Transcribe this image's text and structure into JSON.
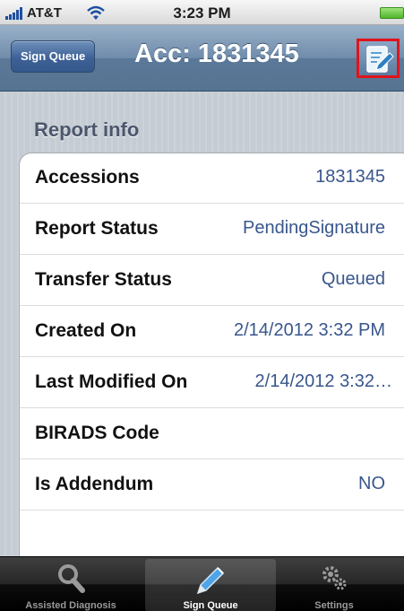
{
  "status_bar": {
    "carrier": "AT&T",
    "time": "3:23 PM"
  },
  "nav": {
    "back_label": "Sign Queue",
    "title": "Acc: 1831345",
    "compose_icon": "edit-document-icon"
  },
  "section": {
    "header": "Report info"
  },
  "rows": [
    {
      "label": "Accessions",
      "value": "1831345"
    },
    {
      "label": "Report Status",
      "value": "PendingSignature"
    },
    {
      "label": "Transfer Status",
      "value": "Queued"
    },
    {
      "label": "Created On",
      "value": "2/14/2012 3:32 PM"
    },
    {
      "label": "Last Modified On",
      "value": "2/14/2012 3:32…"
    },
    {
      "label": "BIRADS Code",
      "value": ""
    },
    {
      "label": "Is Addendum",
      "value": "NO"
    }
  ],
  "tabs": [
    {
      "label": "Assisted Diagnosis",
      "icon": "magnifier-icon",
      "selected": false
    },
    {
      "label": "Sign Queue",
      "icon": "pencil-icon",
      "selected": true
    },
    {
      "label": "Settings",
      "icon": "gears-icon",
      "selected": false
    }
  ],
  "colors": {
    "accent_value": "#39568c",
    "highlight_border": "#e0141b"
  }
}
